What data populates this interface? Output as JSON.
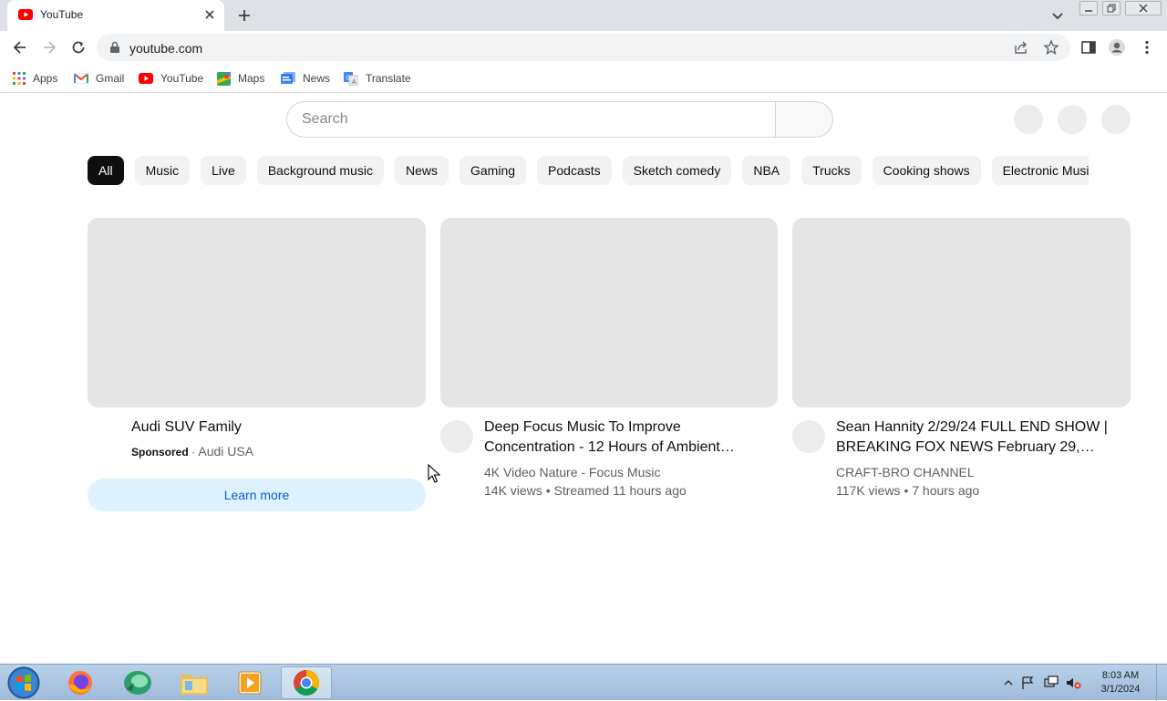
{
  "browser": {
    "tab_title": "YouTube",
    "url": "youtube.com",
    "bookmarks": [
      {
        "label": "Apps",
        "icon": "apps-grid-icon"
      },
      {
        "label": "Gmail",
        "icon": "gmail-icon"
      },
      {
        "label": "YouTube",
        "icon": "youtube-icon"
      },
      {
        "label": "Maps",
        "icon": "maps-icon"
      },
      {
        "label": "News",
        "icon": "news-icon"
      },
      {
        "label": "Translate",
        "icon": "translate-icon"
      }
    ]
  },
  "youtube": {
    "search_placeholder": "Search",
    "chips": [
      "All",
      "Music",
      "Live",
      "Background music",
      "News",
      "Gaming",
      "Podcasts",
      "Sketch comedy",
      "NBA",
      "Trucks",
      "Cooking shows",
      "Electronic Music"
    ],
    "active_chip": "All",
    "ad": {
      "title": "Audi SUV Family",
      "sponsored": "Sponsored",
      "separator": "·",
      "advertiser": "Audi USA",
      "cta": "Learn more"
    },
    "videos": [
      {
        "title": "Deep Focus Music To Improve Concentration - 12 Hours of Ambient…",
        "channel": "4K Video Nature - Focus Music",
        "stats": "14K views • Streamed 11 hours ago"
      },
      {
        "title": "Sean Hannity 2/29/24 FULL END SHOW | BREAKING FOX NEWS February 29,…",
        "channel": "CRAFT-BRO CHANNEL",
        "stats": "117K views • 7 hours ago"
      }
    ]
  },
  "taskbar": {
    "time": "8:03 AM",
    "date": "3/1/2024"
  },
  "colors": {
    "youtube_red": "#ff0000",
    "chip_active_bg": "#0f0f0f",
    "learn_more_bg": "#def1ff",
    "learn_more_text": "#065fd4"
  }
}
